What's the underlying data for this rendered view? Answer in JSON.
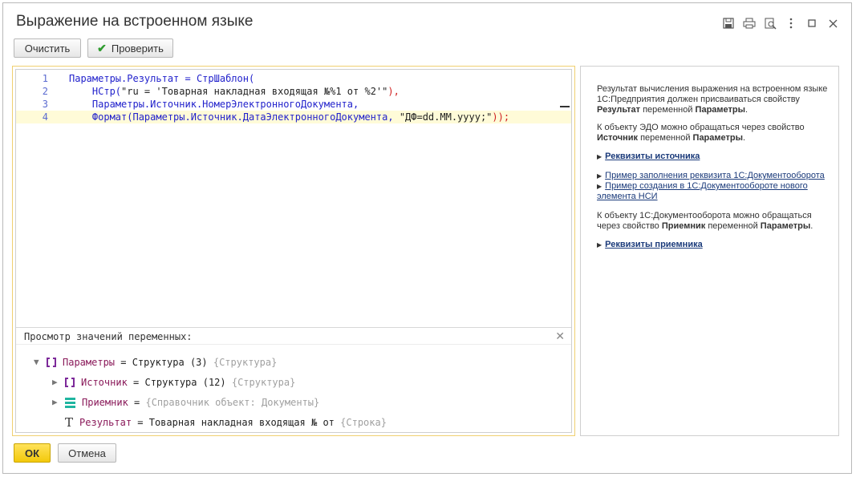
{
  "window": {
    "title": "Выражение на встроенном языке"
  },
  "toolbar": {
    "clear_label": "Очистить",
    "check_label": "Проверить",
    "icons": [
      "save-icon",
      "print-icon",
      "preview-icon",
      "more-icon",
      "maximize-icon",
      "close-icon"
    ]
  },
  "code": {
    "lines": [
      {
        "n": "1",
        "parts": [
          [
            "kw",
            "Параметры.Результат = СтрШаблон("
          ]
        ]
      },
      {
        "n": "2",
        "parts": [
          [
            "kw",
            "    НСтр("
          ],
          [
            "str",
            "\"ru = 'Товарная накладная входящая №%1 от %2'\""
          ],
          [
            "rp",
            "),"
          ]
        ]
      },
      {
        "n": "3",
        "parts": [
          [
            "kw",
            "    Параметры.Источник.НомерЭлектронногоДокумента,"
          ]
        ]
      },
      {
        "n": "4",
        "parts": [
          [
            "kw",
            "    Формат(Параметры.Источник.ДатаЭлектронногоДокумента, "
          ],
          [
            "str",
            "\"ДФ=dd.MM.yyyy;\""
          ],
          [
            "rp",
            "));"
          ]
        ]
      }
    ]
  },
  "vars": {
    "header": "Просмотр значений переменных:",
    "close": "✕",
    "nodes": [
      {
        "name": "Параметры",
        "value": " = Структура (3) ",
        "type": "{Структура}"
      },
      {
        "name": "Источник",
        "value": " = Структура (12) ",
        "type": "{Структура}"
      },
      {
        "name": "Приемник",
        "value": " = ",
        "type": "{Справочник объект: Документы}"
      },
      {
        "name": "Результат",
        "value": " = Товарная накладная входящая № от ",
        "type": "{Строка}"
      }
    ]
  },
  "help": {
    "p1_a": "Результат вычисления выражения на встроенном языке 1С:Предприятия должен присваиваться свойству ",
    "p1_b": "Результат",
    "p1_c": " переменной ",
    "p1_d": "Параметры",
    "p1_e": ".",
    "p2_a": "К объекту ЭДО можно обращаться через свойство ",
    "p2_b": "Источник",
    "p2_c": " переменной ",
    "p2_d": "Параметры",
    "p2_e": ".",
    "link1": "Реквизиты источника",
    "link2": "Пример заполнения реквизита 1С:Документооборота",
    "link3": "Пример создания в 1С:Документообороте нового элемента НСИ",
    "p3_a": "К объекту 1С:Документооборота можно обращаться через свойство ",
    "p3_b": "Приемник",
    "p3_c": " переменной ",
    "p3_d": "Параметры",
    "p3_e": ".",
    "link4": "Реквизиты приемника"
  },
  "footer": {
    "ok_label": "ОК",
    "cancel_label": "Отмена"
  }
}
